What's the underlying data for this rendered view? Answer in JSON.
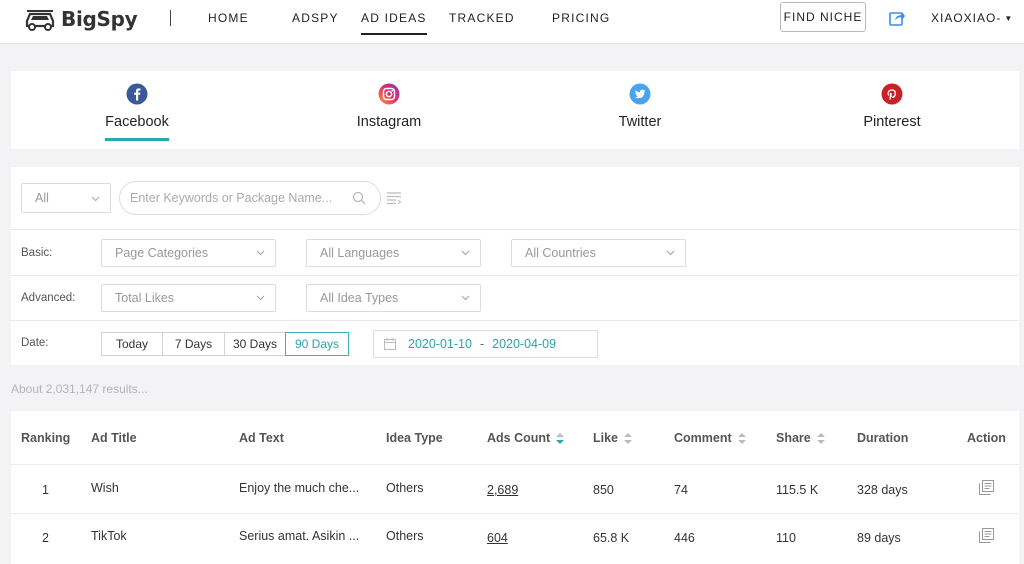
{
  "app": {
    "brand": "BigSpy"
  },
  "nav": {
    "items": [
      "HOME",
      "ADSPY",
      "AD IDEAS",
      "TRACKED",
      "PRICING"
    ],
    "find_niche": "FIND NICHE",
    "user": "XIAOXIAO-"
  },
  "platforms": [
    {
      "label": "Facebook",
      "icon": "facebook-icon",
      "color": "#3b5998"
    },
    {
      "label": "Instagram",
      "icon": "instagram-icon",
      "color": "#c13584"
    },
    {
      "label": "Twitter",
      "icon": "twitter-icon",
      "color": "#1da1f2"
    },
    {
      "label": "Pinterest",
      "icon": "pinterest-icon",
      "color": "#bd081c"
    }
  ],
  "filters": {
    "scope": "All",
    "search_placeholder": "Enter Keywords or Package Name...",
    "basic_label": "Basic:",
    "advanced_label": "Advanced:",
    "date_label": "Date:",
    "page_categories": "Page Categories",
    "languages": "All Languages",
    "countries": "All Countries",
    "total_likes": "Total Likes",
    "idea_types": "All Idea Types",
    "date_buttons": [
      "Today",
      "7 Days",
      "30 Days",
      "90 Days"
    ],
    "date_from": "2020-01-10",
    "date_to": "2020-04-09",
    "date_sep": "-"
  },
  "results_text": "About 2,031,147 results...",
  "table": {
    "headers": [
      "Ranking",
      "Ad Title",
      "Ad Text",
      "Idea Type",
      "Ads Count",
      "Like",
      "Comment",
      "Share",
      "Duration",
      "Action"
    ],
    "rows": [
      {
        "rank": "1",
        "title": "Wish",
        "text": "Enjoy the much che...",
        "type": "Others",
        "ads": "2,689",
        "like": "850",
        "comment": "74",
        "share": "115.5 K",
        "duration": "328 days"
      },
      {
        "rank": "2",
        "title": "TikTok",
        "text": "Serius amat. Asikin ...",
        "type": "Others",
        "ads": "604",
        "like": "65.8 K",
        "comment": "446",
        "share": "110",
        "duration": "89 days"
      }
    ]
  },
  "colors": {
    "accent": "#26a9b0"
  }
}
